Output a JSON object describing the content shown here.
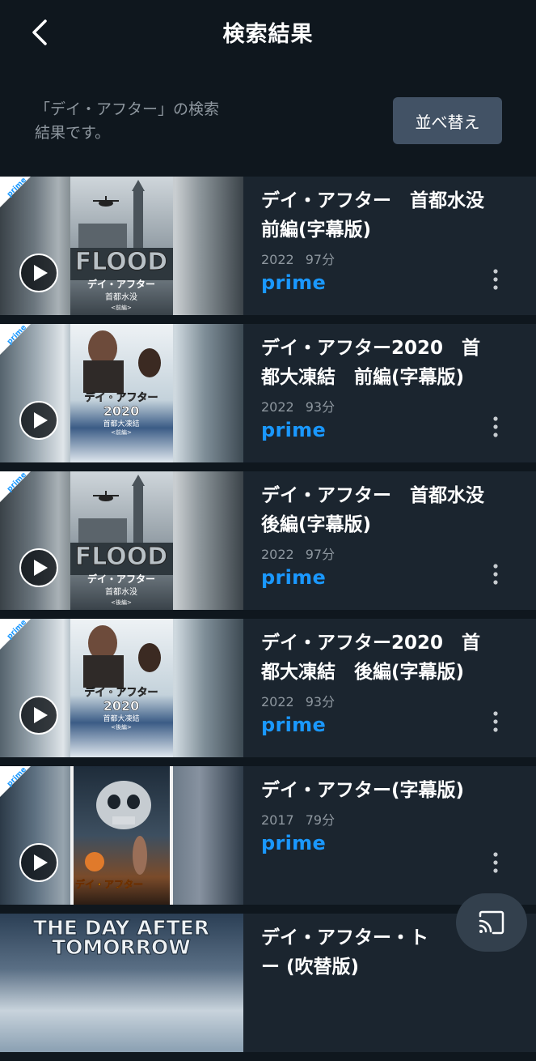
{
  "header": {
    "title": "検索結果"
  },
  "query_info": {
    "line1": "「デイ・アフター」の検索",
    "line2": "結果です。"
  },
  "sort_button": {
    "label": "並べ替え"
  },
  "results": [
    {
      "title_line1": "デイ・アフター　首都水没",
      "title_line2": "前編(字幕版)",
      "year": "2022",
      "duration": "97分",
      "badge": "prime",
      "poster_text": [
        "FLOOD",
        "デイ・アフター",
        "首都水没",
        "<前編>"
      ]
    },
    {
      "title_line1": "デイ・アフター2020　首",
      "title_line2": "都大凍結　前編(字幕版)",
      "year": "2022",
      "duration": "93分",
      "badge": "prime",
      "poster_text": [
        "デイ・アフター",
        "2020",
        "首都大凍結",
        "<前編>"
      ]
    },
    {
      "title_line1": "デイ・アフター　首都水没",
      "title_line2": "後編(字幕版)",
      "year": "2022",
      "duration": "97分",
      "badge": "prime",
      "poster_text": [
        "FLOOD",
        "デイ・アフター",
        "首都水没",
        "<後編>"
      ]
    },
    {
      "title_line1": "デイ・アフター2020　首",
      "title_line2": "都大凍結　後編(字幕版)",
      "year": "2022",
      "duration": "93分",
      "badge": "prime",
      "poster_text": [
        "デイ・アフター",
        "2020",
        "首都大凍結",
        "<後編>"
      ]
    },
    {
      "title_line1": "デイ・アフター(字幕版)",
      "year": "2017",
      "duration": "79分",
      "badge": "prime",
      "poster_text": [
        "デイ・アフター"
      ]
    },
    {
      "title_line1": "デイ・アフター・ト",
      "title_line2": "ー (吹替版)",
      "poster_text": [
        "THE DAY AFTER",
        "TOMORROW"
      ]
    }
  ],
  "icons": {
    "back": "chevron-left-icon",
    "play": "play-icon",
    "more": "more-vertical-icon",
    "prime_corner": "prime-corner-badge-icon",
    "cast": "cast-icon"
  },
  "colors": {
    "background": "#0f171e",
    "card": "#1b252f",
    "prime_blue": "#1a98ff",
    "button": "#425265",
    "muted_text": "#8e979f"
  }
}
